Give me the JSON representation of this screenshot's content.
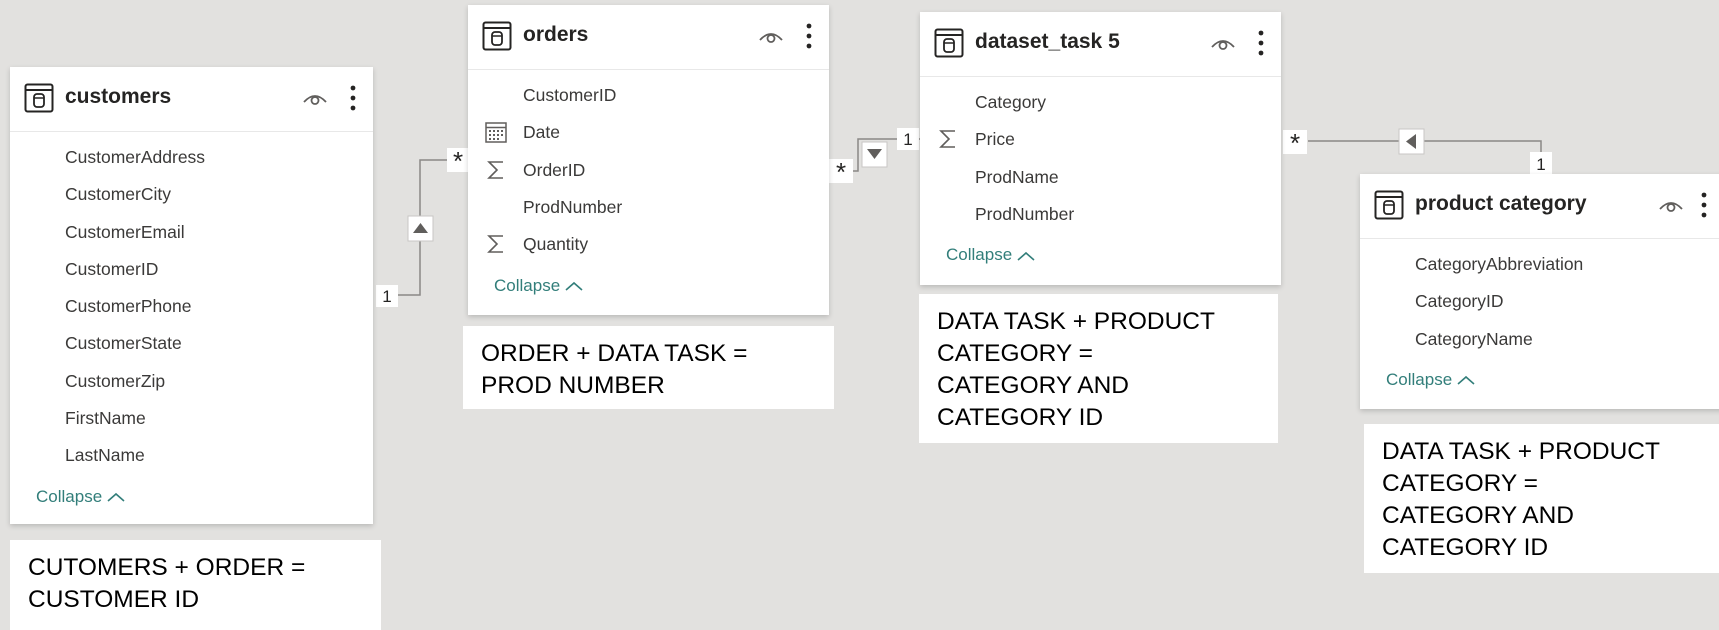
{
  "tables": [
    {
      "title": "customers",
      "fields": [
        {
          "label": "CustomerAddress",
          "icon": "none"
        },
        {
          "label": "CustomerCity",
          "icon": "none"
        },
        {
          "label": "CustomerEmail",
          "icon": "none"
        },
        {
          "label": "CustomerID",
          "icon": "none"
        },
        {
          "label": "CustomerPhone",
          "icon": "none"
        },
        {
          "label": "CustomerState",
          "icon": "none"
        },
        {
          "label": "CustomerZip",
          "icon": "none"
        },
        {
          "label": "FirstName",
          "icon": "none"
        },
        {
          "label": "LastName",
          "icon": "none"
        }
      ],
      "collapse_label": "Collapse"
    },
    {
      "title": "orders",
      "fields": [
        {
          "label": "CustomerID",
          "icon": "none"
        },
        {
          "label": "Date",
          "icon": "calendar-icon"
        },
        {
          "label": "OrderID",
          "icon": "sigma-icon"
        },
        {
          "label": "ProdNumber",
          "icon": "none"
        },
        {
          "label": "Quantity",
          "icon": "sigma-icon"
        }
      ],
      "collapse_label": "Collapse"
    },
    {
      "title": "dataset_task 5",
      "fields": [
        {
          "label": "Category",
          "icon": "none"
        },
        {
          "label": "Price",
          "icon": "sigma-icon"
        },
        {
          "label": "ProdName",
          "icon": "none"
        },
        {
          "label": "ProdNumber",
          "icon": "none"
        }
      ],
      "collapse_label": "Collapse"
    },
    {
      "title": "product category",
      "fields": [
        {
          "label": "CategoryAbbreviation",
          "icon": "none"
        },
        {
          "label": "CategoryID",
          "icon": "none"
        },
        {
          "label": "CategoryName",
          "icon": "none"
        }
      ],
      "collapse_label": "Collapse"
    }
  ],
  "notes": [
    {
      "line1": "CUTOMERS + ORDER =",
      "line2": "CUSTOMER ID"
    },
    {
      "line1": "ORDER + DATA TASK =",
      "line2": "PROD NUMBER"
    },
    {
      "line1": "DATA TASK + PRODUCT",
      "line2": "CATEGORY =",
      "line3": "CATEGORY AND",
      "line4": "CATEGORY ID"
    },
    {
      "line1": "DATA TASK + PRODUCT",
      "line2": "CATEGORY =",
      "line3": "CATEGORY AND",
      "line4": "CATEGORY ID"
    }
  ],
  "relationships": [
    {
      "from": "customers",
      "to": "orders",
      "from_cardinality": "1",
      "to_cardinality": "*"
    },
    {
      "from": "orders",
      "to": "dataset_task 5",
      "from_cardinality": "*",
      "to_cardinality": "1"
    },
    {
      "from": "dataset_task 5",
      "to": "product category",
      "from_cardinality": "*",
      "to_cardinality": "1"
    }
  ],
  "colors": {
    "canvas": "#e2e1df",
    "collapse_link": "#327e7a",
    "line": "#605e5c"
  }
}
